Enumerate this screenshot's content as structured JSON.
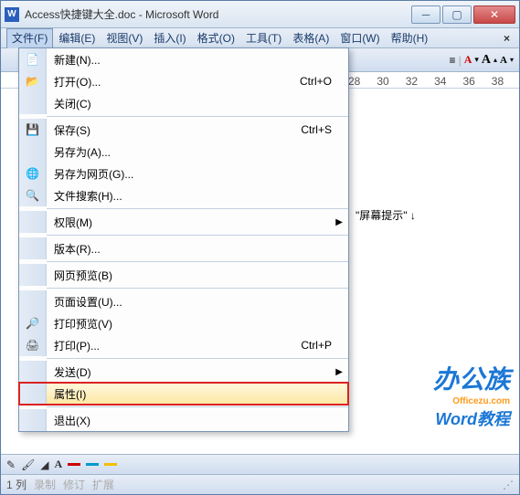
{
  "title": "Access快捷键大全.doc - Microsoft Word",
  "app_icon_letter": "W",
  "menubar": {
    "items": [
      {
        "label": "文件(F)",
        "open": true
      },
      {
        "label": "编辑(E)"
      },
      {
        "label": "视图(V)"
      },
      {
        "label": "插入(I)"
      },
      {
        "label": "格式(O)"
      },
      {
        "label": "工具(T)"
      },
      {
        "label": "表格(A)"
      },
      {
        "label": "窗口(W)"
      },
      {
        "label": "帮助(H)"
      }
    ]
  },
  "file_menu": [
    {
      "icon": "new",
      "label": "新建(N)...",
      "shortcut": ""
    },
    {
      "icon": "open",
      "label": "打开(O)...",
      "shortcut": "Ctrl+O"
    },
    {
      "icon": "",
      "label": "关闭(C)",
      "shortcut": ""
    },
    {
      "sep": true
    },
    {
      "icon": "save",
      "label": "保存(S)",
      "shortcut": "Ctrl+S"
    },
    {
      "icon": "",
      "label": "另存为(A)...",
      "shortcut": ""
    },
    {
      "icon": "savew",
      "label": "另存为网页(G)...",
      "shortcut": ""
    },
    {
      "icon": "search",
      "label": "文件搜索(H)...",
      "shortcut": ""
    },
    {
      "sep": true
    },
    {
      "icon": "",
      "label": "权限(M)",
      "shortcut": "",
      "sub": true
    },
    {
      "sep": true
    },
    {
      "icon": "",
      "label": "版本(R)...",
      "shortcut": ""
    },
    {
      "sep": true
    },
    {
      "icon": "",
      "label": "网页预览(B)",
      "shortcut": ""
    },
    {
      "sep": true
    },
    {
      "icon": "",
      "label": "页面设置(U)...",
      "shortcut": ""
    },
    {
      "icon": "preview",
      "label": "打印预览(V)",
      "shortcut": ""
    },
    {
      "icon": "print",
      "label": "打印(P)...",
      "shortcut": "Ctrl+P"
    },
    {
      "sep": true
    },
    {
      "icon": "",
      "label": "发送(D)",
      "shortcut": "",
      "sub": true
    },
    {
      "icon": "",
      "label": "属性(I)",
      "shortcut": "",
      "highlight": true
    },
    {
      "sep": true
    },
    {
      "icon": "",
      "label": "退出(X)",
      "shortcut": ""
    }
  ],
  "ruler_ticks": [
    "28",
    "30",
    "32",
    "34",
    "36",
    "38"
  ],
  "document_text": "\"屏幕提示\"  ↓",
  "statusbar": {
    "col": "1 列",
    "rec": "录制",
    "rev": "修订",
    "ext": "扩展"
  },
  "toolstrip": {
    "font_color_letter": "A",
    "grow": "A",
    "shrink": "A"
  },
  "drawtools": {
    "swatches": [
      "#c00",
      "#09c",
      "#f0c000"
    ]
  },
  "watermark": {
    "l1": "办公族",
    "l2": "Officezu.com",
    "l3": "Word教程"
  }
}
